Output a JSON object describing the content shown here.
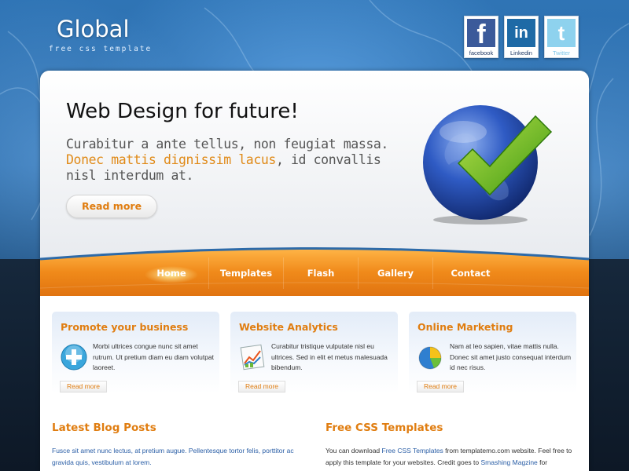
{
  "header": {
    "logo": "Global",
    "tagline": "free css template",
    "social": [
      {
        "glyph": "f",
        "label": "facebook"
      },
      {
        "glyph": "in",
        "label": "Linkedin"
      },
      {
        "glyph": "t",
        "label": "Twitter"
      }
    ]
  },
  "hero": {
    "title": "Web Design for future!",
    "text_before": "Curabitur a ante tellus, non feugiat massa. ",
    "text_highlight": "Donec mattis dignissim lacus",
    "text_after": ", id convallis nisl interdum at.",
    "button": "Read more"
  },
  "nav": {
    "items": [
      "Home",
      "Templates",
      "Flash",
      "Gallery",
      "Contact"
    ],
    "active": "Home"
  },
  "boxes": [
    {
      "title": "Promote your business",
      "icon": "plus-icon",
      "text": "Morbi ultrices congue nunc sit amet rutrum. Ut pretium diam eu diam volutpat laoreet.",
      "button": "Read more"
    },
    {
      "title": "Website Analytics",
      "icon": "chart-icon",
      "text": "Curabitur tristique vulputate nisl eu ultrices. Sed in elit et metus malesuada bibendum.",
      "button": "Read more"
    },
    {
      "title": "Online Marketing",
      "icon": "pie-chart-icon",
      "text": "Nam at leo sapien, vitae mattis nulla. Donec sit amet justo consequat interdum id nec risus.",
      "button": "Read more"
    }
  ],
  "blog": {
    "title": "Latest Blog Posts",
    "text": "Fusce sit amet nunc lectus, at pretium augue. Pellentesque tortor felis, porttitor ac gravida quis, vestibulum at lorem."
  },
  "css_templates": {
    "title": "Free CSS Templates",
    "p1": "You can download ",
    "link1": "Free CSS Templates",
    "p2": " from templatemo.com website. Feel free to apply this template for your websites. Credit goes to ",
    "link2": "Smashing Magzine",
    "p3": " for"
  },
  "colors": {
    "accent": "#e07d10",
    "link": "#2a5ea6",
    "nav": "#ee8a1a"
  }
}
